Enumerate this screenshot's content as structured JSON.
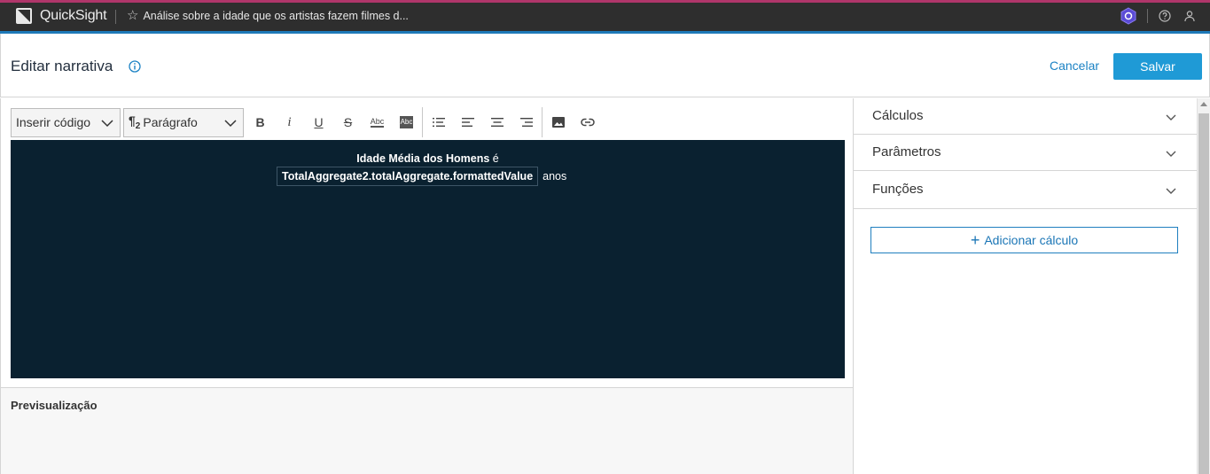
{
  "topbar": {
    "app_name": "QuickSight",
    "analysis_title": "Análise sobre a idade que os artistas fazem filmes d...",
    "icons": [
      "quicksight-logo-icon",
      "star-icon",
      "hexagon-extension-icon",
      "help-icon",
      "user-icon"
    ]
  },
  "header": {
    "title": "Editar narrativa",
    "cancel_label": "Cancelar",
    "save_label": "Salvar"
  },
  "toolbar": {
    "insert_code": "Inserir código",
    "paragraph_symbol": "¶",
    "paragraph_subscript": "2",
    "paragraph_label": "Parágrafo",
    "bold": "B",
    "italic": "i",
    "underline": "U",
    "strike": "S",
    "font_size": "Abc",
    "highlight": "Abc"
  },
  "editor": {
    "line1_bold": "Idade Média dos Homens",
    "line1_tail": " é",
    "code_value": "TotalAggregate2.totalAggregate.formattedValue",
    "line2_tail": "anos"
  },
  "preview": {
    "title": "Previsualização"
  },
  "side_panel": {
    "sections": [
      {
        "label": "Cálculos"
      },
      {
        "label": "Parâmetros"
      },
      {
        "label": "Funções"
      }
    ],
    "add_button_label": "Adicionar cálculo"
  },
  "colors": {
    "topbar_bg": "#2e2e2e",
    "accent_blue": "#1f9ad6",
    "canvas_bg": "#0a2130",
    "top_border_magenta": "#b0366a"
  }
}
